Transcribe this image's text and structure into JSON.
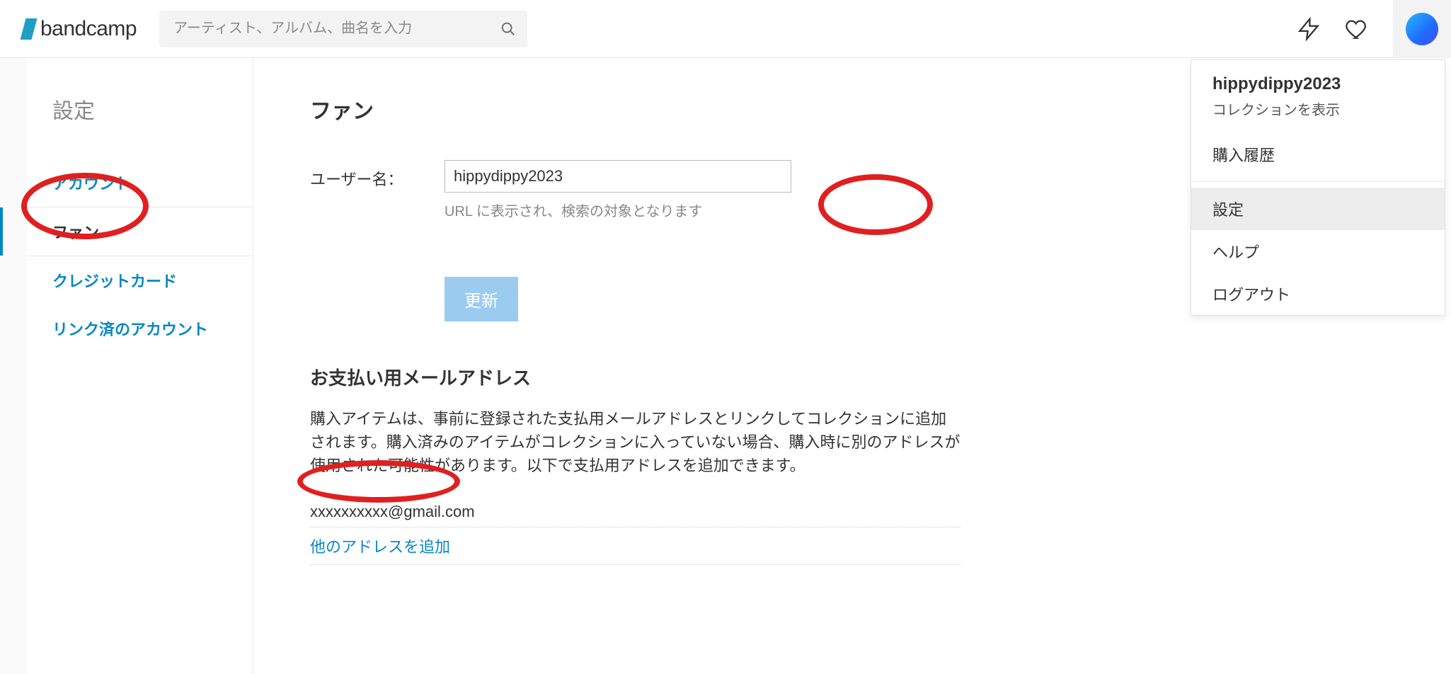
{
  "header": {
    "logo_text": "bandcamp",
    "search_placeholder": "アーティスト、アルバム、曲名を入力"
  },
  "dropdown": {
    "username": "hippydippy2023",
    "view_collection": "コレクションを表示",
    "items": {
      "purchases": "購入履歴",
      "settings": "設定",
      "help": "ヘルプ",
      "logout": "ログアウト"
    }
  },
  "sidebar": {
    "title": "設定",
    "items": {
      "account": "アカウント",
      "fan": "ファン",
      "credit_card": "クレジットカード",
      "linked_accounts": "リンク済のアカウント"
    }
  },
  "main": {
    "title": "ファン",
    "username_label": "ユーザー名：",
    "username_value": "hippydippy2023",
    "username_help": "URL に表示され、検索の対象となります",
    "update_button": "更新",
    "payment_email_title": "お支払い用メールアドレス",
    "payment_email_desc": "購入アイテムは、事前に登録された支払用メールアドレスとリンクしてコレクションに追加されます。購入済みのアイテムがコレクションに入っていない場合、購入時に別のアドレスが使用された可能性があります。以下で支払用アドレスを追加できます。",
    "payment_email_value": "xxxxxxxxxx@gmail.com",
    "add_address_link": "他のアドレスを追加"
  }
}
